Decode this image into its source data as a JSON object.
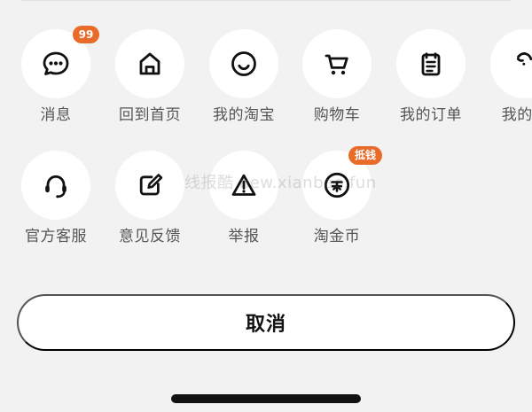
{
  "row1": [
    {
      "label": "消息",
      "badge": "99",
      "icon": "message-dots"
    },
    {
      "label": "回到首页",
      "icon": "house"
    },
    {
      "label": "我的淘宝",
      "icon": "smile"
    },
    {
      "label": "购物车",
      "icon": "shopping-cart"
    },
    {
      "label": "我的订单",
      "icon": "notepad"
    },
    {
      "label": "我的足",
      "icon": "footprint"
    }
  ],
  "row2": [
    {
      "label": "官方客服",
      "icon": "headset"
    },
    {
      "label": "意见反馈",
      "icon": "edit-square"
    },
    {
      "label": "举报",
      "icon": "warning-triangle"
    },
    {
      "label": "淘金币",
      "badge": "抵钱",
      "icon": "coin"
    }
  ],
  "watermark": "线报酷 new.xianbao.fun",
  "cancel_label": "取消",
  "colors": {
    "background": "#f2f2f2",
    "card": "#ffffff",
    "text": "#111111",
    "label": "#555555",
    "badge": "#e86b2a"
  }
}
